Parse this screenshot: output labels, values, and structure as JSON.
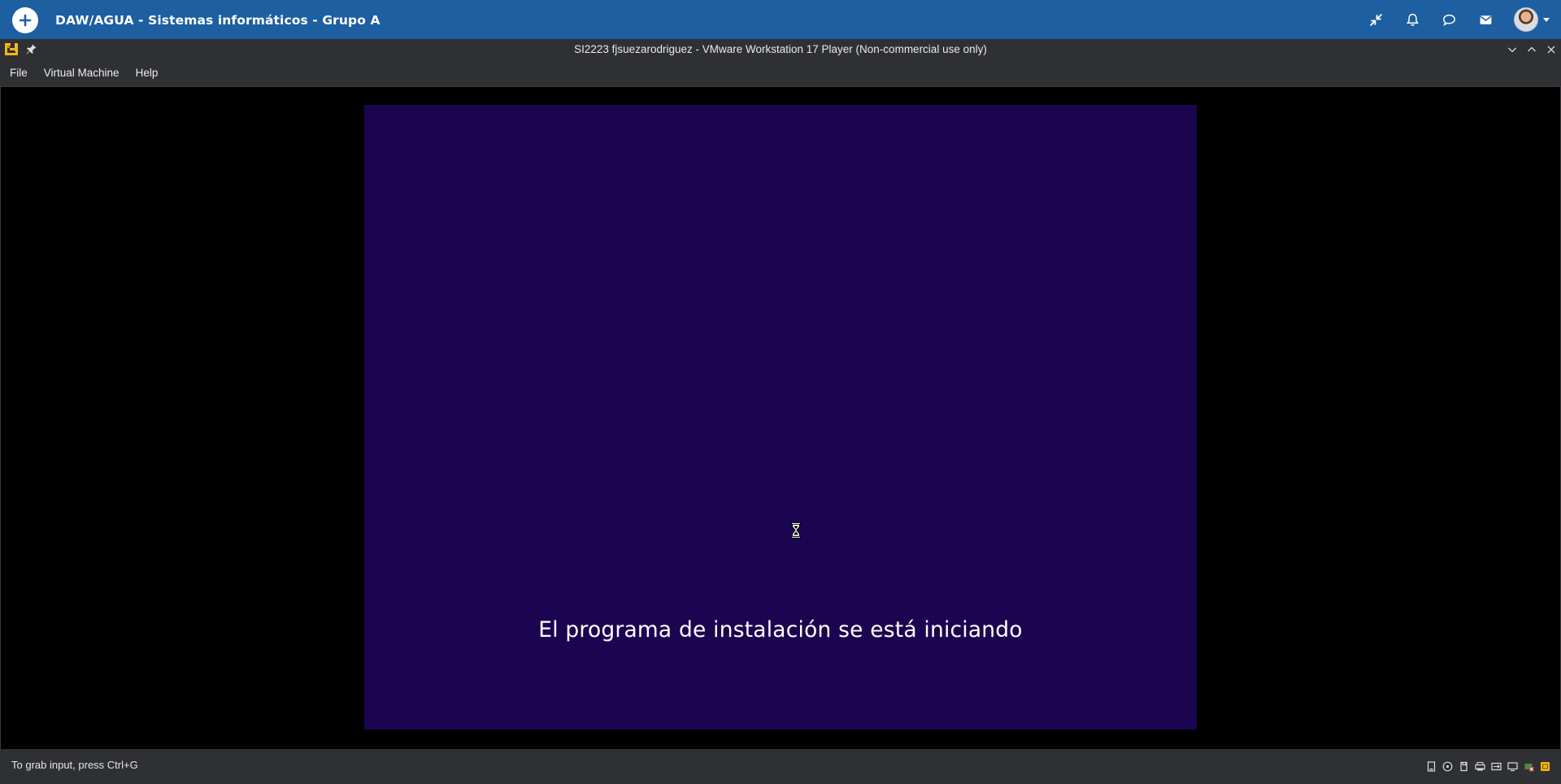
{
  "appbar": {
    "title": "DAW/AGUA - Sistemas informáticos - Grupo A",
    "icons": [
      "add-icon",
      "collapse-icon",
      "bell-icon",
      "chat-icon",
      "mail-icon",
      "avatar"
    ],
    "color": "#1d5fa0"
  },
  "window": {
    "title": "SI2223 fjsuezarodriguez - VMware Workstation 17 Player (Non-commercial use only)",
    "controls": [
      "minimize-icon",
      "maximize-icon",
      "close-icon"
    ]
  },
  "menu": {
    "items": [
      {
        "label": "File"
      },
      {
        "label": "Virtual Machine"
      },
      {
        "label": "Help"
      }
    ]
  },
  "vm": {
    "message": "El programa de instalación se está iniciando",
    "background": "#1c0550"
  },
  "status": {
    "text": "To grab input, press Ctrl+G",
    "device_icons": [
      "hard-disk-icon",
      "cd-dvd-icon",
      "floppy-icon",
      "printer-icon",
      "network-icon",
      "display-icon",
      "usb-icon",
      "vm-message-icon"
    ]
  }
}
